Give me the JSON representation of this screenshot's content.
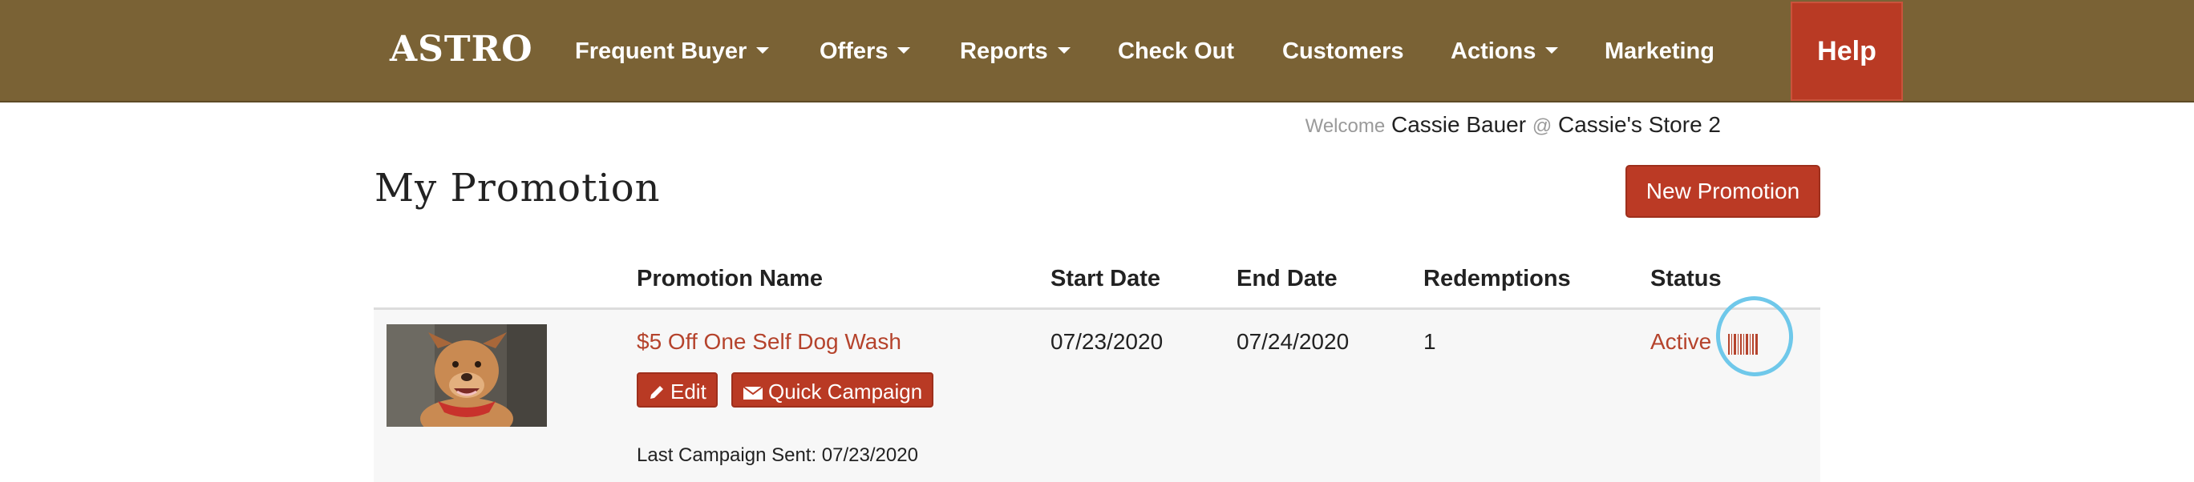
{
  "navbar": {
    "logo": "ASTRO",
    "items": [
      {
        "label": "Frequent Buyer",
        "dropdown": true
      },
      {
        "label": "Offers",
        "dropdown": true
      },
      {
        "label": "Reports",
        "dropdown": true
      },
      {
        "label": "Check Out",
        "dropdown": false
      },
      {
        "label": "Customers",
        "dropdown": false
      },
      {
        "label": "Actions",
        "dropdown": true
      },
      {
        "label": "Marketing",
        "dropdown": false
      }
    ],
    "help_label": "Help"
  },
  "welcome": {
    "prefix": "Welcome",
    "user": "Cassie Bauer",
    "separator": "@",
    "store": "Cassie's Store 2"
  },
  "page": {
    "title": "My Promotion",
    "new_button": "New Promotion"
  },
  "table": {
    "columns": [
      "Promotion Name",
      "Start Date",
      "End Date",
      "Redemptions",
      "Status"
    ],
    "rows": [
      {
        "image": "dog-photo",
        "name": "$5 Off One Self Dog Wash",
        "start_date": "07/23/2020",
        "end_date": "07/24/2020",
        "redemptions": "1",
        "status": "Active",
        "edit_label": "Edit",
        "quick_campaign_label": "Quick Campaign",
        "last_campaign": "Last Campaign Sent: 07/23/2020"
      }
    ]
  },
  "colors": {
    "navbar": "#7a6235",
    "accent": "#b93a24",
    "link": "#b5432c",
    "highlight": "#6fc8ea"
  }
}
